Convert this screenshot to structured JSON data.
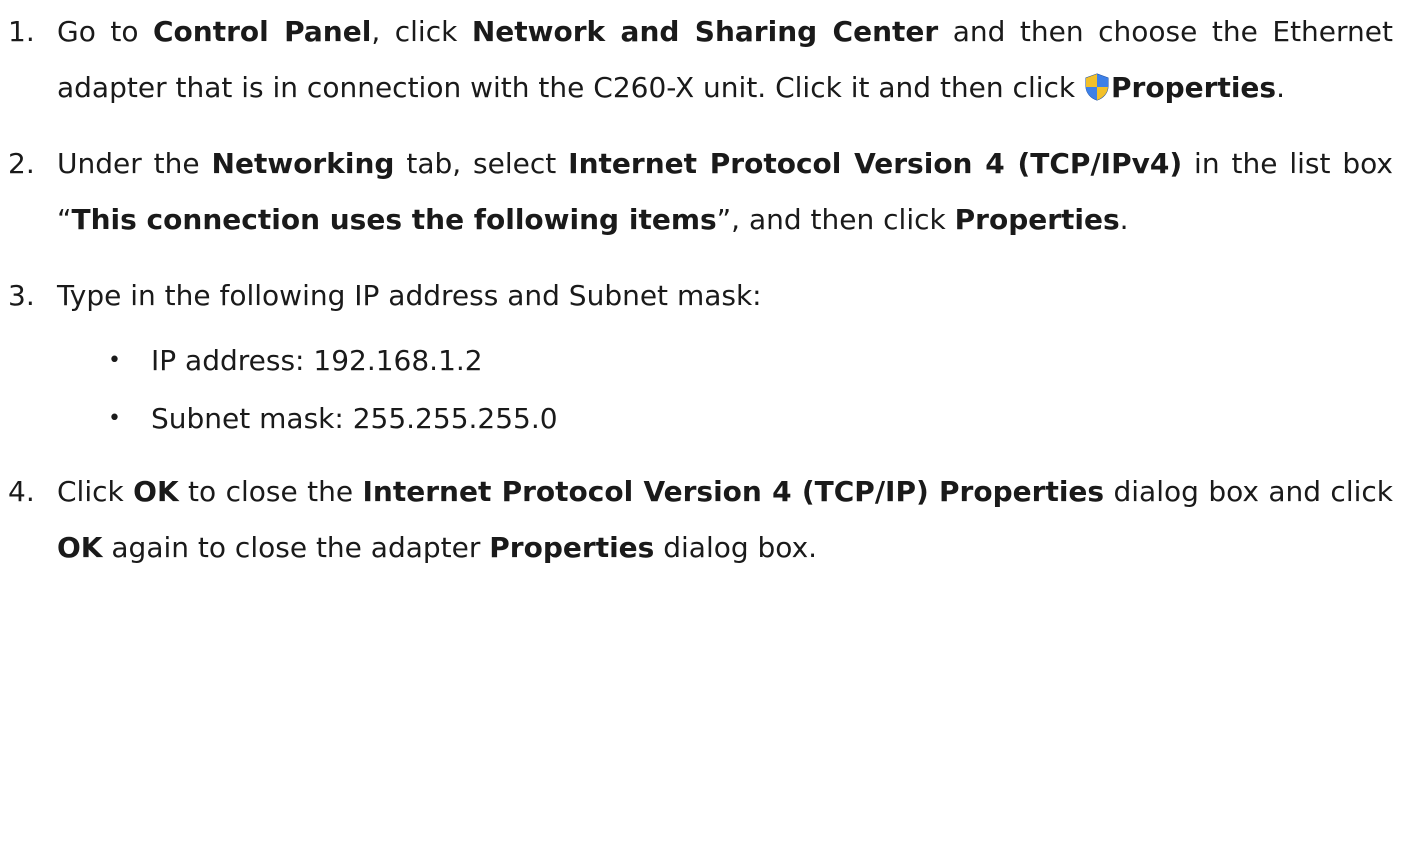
{
  "steps": [
    {
      "number": "1.",
      "parts": {
        "t1": "Go to ",
        "b1": "Control Panel",
        "t2": ", click ",
        "b2": "Network and Sharing Center",
        "t3": " and then choose the Ethernet adapter that is in connection with the C260-X unit. Click it and then click ",
        "icon": "uac-shield-icon",
        "b3": "Properties",
        "t4": "."
      }
    },
    {
      "number": "2.",
      "parts": {
        "t1": "Under the ",
        "b1": "Networking",
        "t2": " tab, select ",
        "b2": "Internet Protocol Version 4 (TCP/IPv4)",
        "t3": " in the list box “",
        "b3": "This connection uses the following items",
        "t4": "”, and then click ",
        "b4": "Properties",
        "t5": "."
      }
    },
    {
      "number": "3.",
      "parts": {
        "t1": "Type in the following IP address and Subnet mask:"
      },
      "bullets": [
        "IP address: 192.168.1.2",
        "Subnet mask: 255.255.255.0"
      ]
    },
    {
      "number": "4.",
      "parts": {
        "t1": "Click ",
        "b1": "OK",
        "t2": " to close the ",
        "b2": "Internet Protocol Version 4 (TCP/IP) Properties",
        "t3": " dialog box and click ",
        "b3": "OK",
        "t4": " again to close the adapter ",
        "b4": "Properties",
        "t5": " dialog box."
      }
    }
  ],
  "bullet_glyph": "•",
  "colors": {
    "text": "#1a1a1a",
    "shield_blue": "#2f6fd6",
    "shield_yellow": "#f2c029"
  }
}
